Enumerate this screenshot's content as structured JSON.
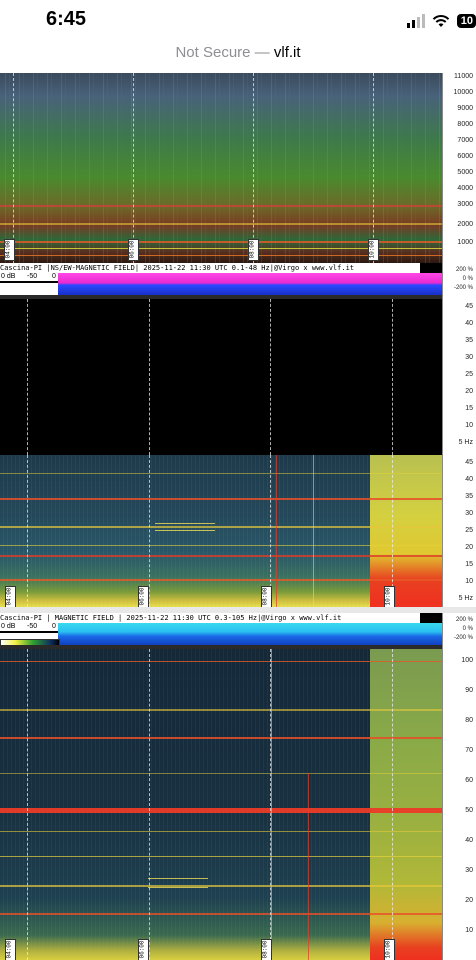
{
  "status_bar": {
    "time": "6:45",
    "battery": "10"
  },
  "browser": {
    "security": "Not Secure —",
    "domain": "vlf.it"
  },
  "panel_top": {
    "freq_ticks": [
      "11000",
      "10000",
      "9000",
      "8000",
      "7000",
      "6000",
      "5000",
      "4000",
      "3000",
      "2000",
      "1000"
    ],
    "time_labels": [
      "04:00",
      "06:00",
      "08:00",
      "10:00"
    ]
  },
  "panel_a": {
    "header": "Cascina-PI |NS/EW-MAGNETIC FIELD| 2025-11-22 11:30 UTC 0.1-48 Hz|@Virgo x www.vlf.it",
    "colorbar": {
      "label_0": "0 dB",
      "label_mid": "-50",
      "label_end": "0"
    },
    "pct_labels": [
      "200 %",
      "0 %",
      "-200 %"
    ],
    "dark_ticks": [
      "45",
      "40",
      "35",
      "30",
      "25",
      "20",
      "15",
      "10",
      "5 Hz"
    ],
    "spec_ticks": [
      "45",
      "40",
      "35",
      "30",
      "25",
      "20",
      "15",
      "10",
      "5 Hz"
    ],
    "time_labels": [
      "04:00",
      "06:00",
      "08:00",
      "10:00"
    ]
  },
  "panel_b": {
    "header": "Cascina-PI | MAGNETIC FIELD | 2025-11-22 11:30 UTC 0.3-105 Hz|@Virgo x www.vlf.it",
    "colorbar": {
      "label_0": "0 dB",
      "label_mid": "-50",
      "label_end": "0"
    },
    "pct_labels": [
      "200 %",
      "0 %",
      "-200 %"
    ],
    "spec_ticks": [
      "100",
      "90",
      "80",
      "70",
      "60",
      "50",
      "40",
      "30",
      "20",
      "10"
    ],
    "time_labels": [
      "04:00",
      "06:00",
      "08:00",
      "10:00"
    ]
  }
}
